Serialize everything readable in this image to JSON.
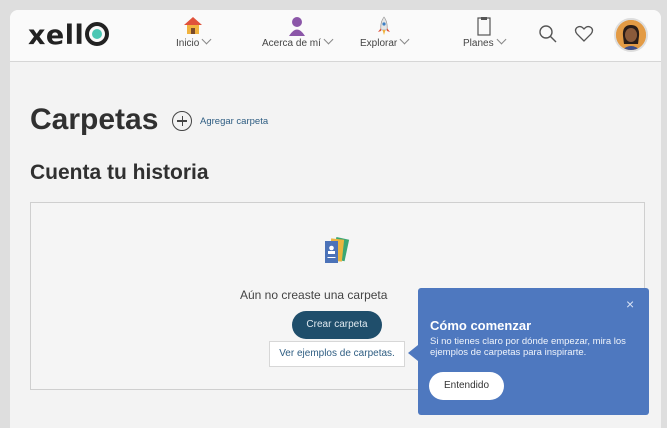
{
  "app": {
    "logo": "xell"
  },
  "nav": [
    {
      "label": "Inicio",
      "icon": "house-icon"
    },
    {
      "label": "Acerca de mí",
      "icon": "person-icon"
    },
    {
      "label": "Explorar",
      "icon": "rocket-icon"
    },
    {
      "label": "Planes",
      "icon": "clipboard-icon"
    }
  ],
  "header_icons": [
    "search-icon",
    "heart-icon",
    "avatar"
  ],
  "page": {
    "title": "Carpetas",
    "add_folder_label": "Agregar carpeta",
    "section_title": "Cuenta tu historia"
  },
  "empty_state": {
    "message": "Aún no creaste una carpeta",
    "create_button": "Crear carpeta",
    "examples_link": "Ver ejemplos de carpetas."
  },
  "popover": {
    "title": "Cómo comenzar",
    "body": "Si no tienes claro por dónde empezar, mira los ejemplos de carpetas para inspirarte.",
    "button": "Entendido",
    "close": "×"
  },
  "colors": {
    "popover": "#4e78bf",
    "primary_button": "#1f4e6b",
    "logo_accent": "#4cc7b4"
  }
}
